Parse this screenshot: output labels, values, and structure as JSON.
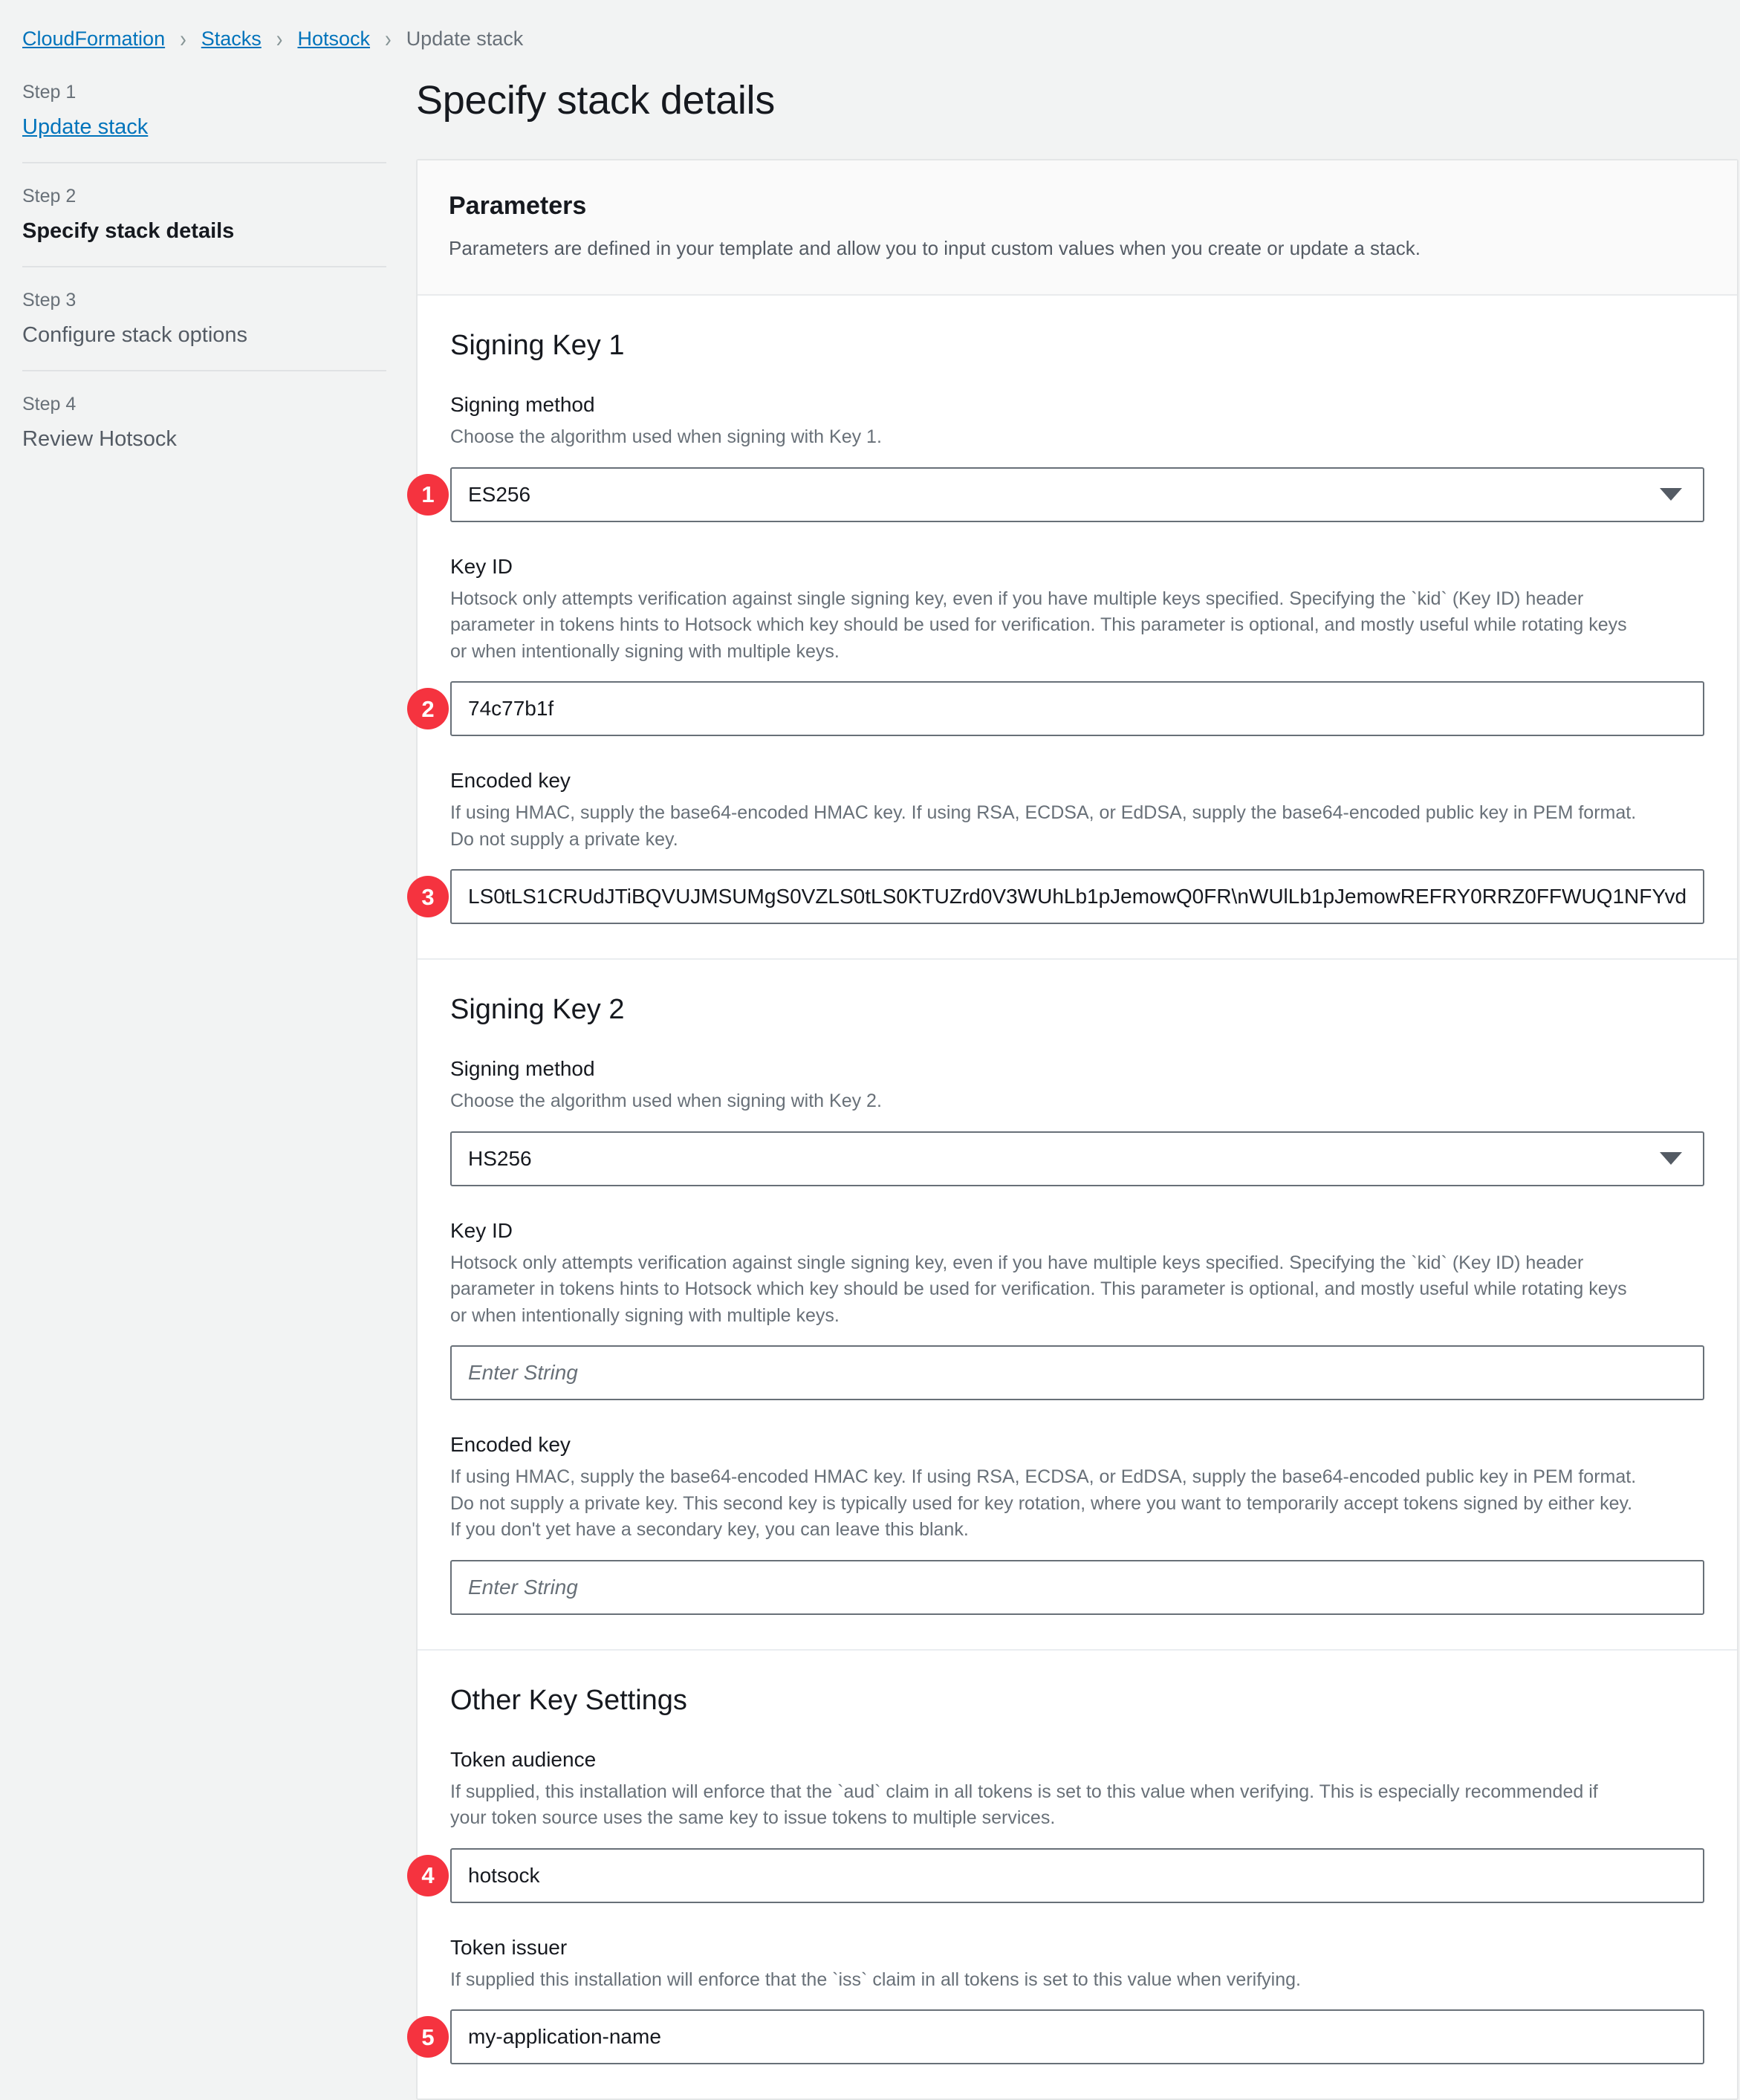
{
  "breadcrumb": {
    "items": [
      {
        "label": "CloudFormation",
        "type": "link"
      },
      {
        "label": "Stacks",
        "type": "link"
      },
      {
        "label": "Hotsock",
        "type": "link"
      },
      {
        "label": "Update stack",
        "type": "current"
      }
    ],
    "separator": "›"
  },
  "sidebar": {
    "steps": [
      {
        "kicker": "Step 1",
        "title": "Update stack",
        "state": "link"
      },
      {
        "kicker": "Step 2",
        "title": "Specify stack details",
        "state": "active"
      },
      {
        "kicker": "Step 3",
        "title": "Configure stack options",
        "state": "normal"
      },
      {
        "kicker": "Step 4",
        "title": "Review Hotsock",
        "state": "normal"
      }
    ]
  },
  "main": {
    "page_title": "Specify stack details",
    "panel": {
      "header_title": "Parameters",
      "header_desc": "Parameters are defined in your template and allow you to input custom values when you create or update a stack."
    },
    "sections": [
      {
        "heading": "Signing Key 1",
        "fields": [
          {
            "label": "Signing method",
            "hint": "Choose the algorithm used when signing with Key 1.",
            "control": "select",
            "value": "ES256",
            "badge": "1"
          },
          {
            "label": "Key ID",
            "hint": "Hotsock only attempts verification against single signing key, even if you have multiple keys specified. Specifying the `kid` (Key ID) header parameter in tokens hints to Hotsock which key should be used for verification. This parameter is optional, and mostly useful while rotating keys or when intentionally signing with multiple keys.",
            "control": "input",
            "value": "74c77b1f",
            "badge": "2"
          },
          {
            "label": "Encoded key",
            "hint": "If using HMAC, supply the base64-encoded HMAC key. If using RSA, ECDSA, or EdDSA, supply the base64-encoded public key in PEM format. Do not supply a private key.",
            "control": "input",
            "value": "LS0tLS1CRUdJTiBQVUJMSUMgS0VZLS0tLS0KTUZrd0V3WUhLb1pJemowQ0FR\\nWUlLb1pJemowREFRY0RRZ0FFWUQ1NFYvd",
            "badge": "3"
          }
        ]
      },
      {
        "heading": "Signing Key 2",
        "fields": [
          {
            "label": "Signing method",
            "hint": "Choose the algorithm used when signing with Key 2.",
            "control": "select",
            "value": "HS256",
            "badge": ""
          },
          {
            "label": "Key ID",
            "hint": "Hotsock only attempts verification against single signing key, even if you have multiple keys specified. Specifying the `kid` (Key ID) header parameter in tokens hints to Hotsock which key should be used for verification. This parameter is optional, and mostly useful while rotating keys or when intentionally signing with multiple keys.",
            "control": "input",
            "value": "",
            "placeholder": "Enter String",
            "badge": ""
          },
          {
            "label": "Encoded key",
            "hint": "If using HMAC, supply the base64-encoded HMAC key. If using RSA, ECDSA, or EdDSA, supply the base64-encoded public key in PEM format. Do not supply a private key. This second key is typically used for key rotation, where you want to temporarily accept tokens signed by either key. If you don't yet have a secondary key, you can leave this blank.",
            "control": "input",
            "value": "",
            "placeholder": "Enter String",
            "badge": ""
          }
        ]
      },
      {
        "heading": "Other Key Settings",
        "fields": [
          {
            "label": "Token audience",
            "hint": "If supplied, this installation will enforce that the `aud` claim in all tokens is set to this value when verifying. This is especially recommended if your token source uses the same key to issue tokens to multiple services.",
            "control": "input",
            "value": "hotsock",
            "badge": "4"
          },
          {
            "label": "Token issuer",
            "hint": "If supplied this installation will enforce that the `iss` claim in all tokens is set to this value when verifying.",
            "control": "input",
            "value": "my-application-name",
            "badge": "5"
          }
        ]
      }
    ]
  },
  "colors": {
    "badge": "#f5333f",
    "link": "#0073bb",
    "page_bg": "#f2f3f3"
  }
}
